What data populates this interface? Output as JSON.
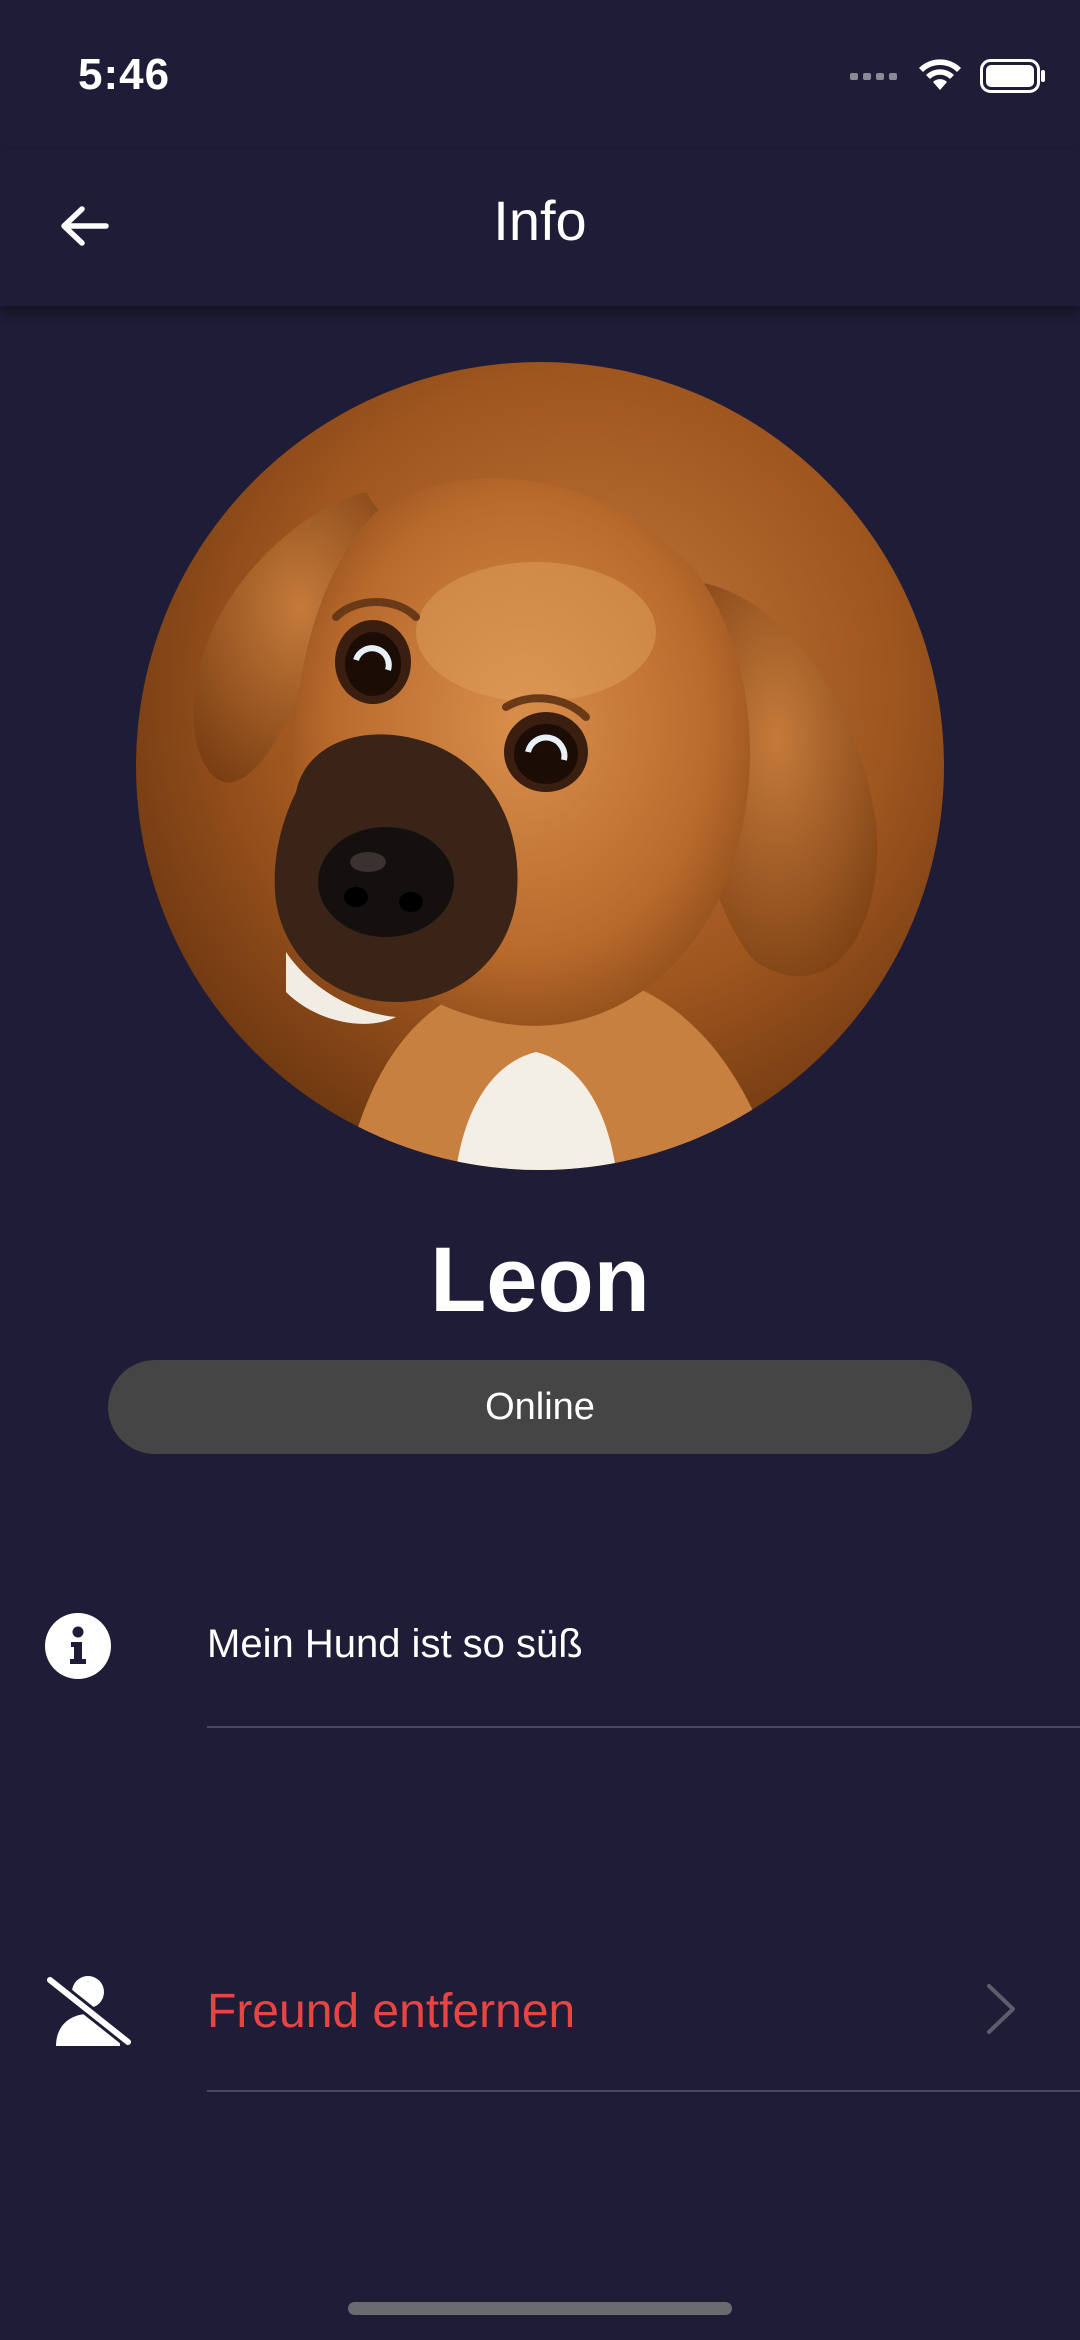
{
  "status_bar": {
    "time": "5:46"
  },
  "nav": {
    "title": "Info",
    "back_icon": "arrow-left-icon"
  },
  "profile": {
    "name": "Leon",
    "status": "Online",
    "avatar_subject": "puppy photo"
  },
  "about": {
    "icon": "info-circle-icon",
    "text": "Mein Hund ist so süß"
  },
  "actions": {
    "remove_friend": {
      "label": "Freund entfernen",
      "icon": "user-remove-icon",
      "chevron": "chevron-right-icon",
      "color": "#e84444"
    }
  },
  "colors": {
    "background": "#1e1c36",
    "status_pill": "#454545",
    "danger": "#e84444"
  }
}
